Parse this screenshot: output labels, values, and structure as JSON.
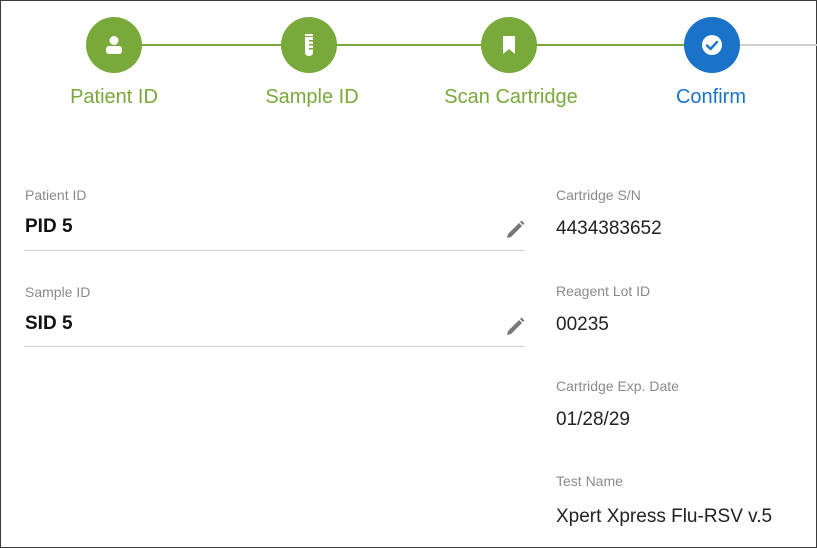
{
  "stepper": {
    "steps": [
      {
        "label": "Patient ID",
        "icon": "person-icon",
        "state": "complete"
      },
      {
        "label": "Sample ID",
        "icon": "sample-tube-icon",
        "state": "complete"
      },
      {
        "label": "Scan Cartridge",
        "icon": "cartridge-icon",
        "state": "complete"
      },
      {
        "label": "Confirm",
        "icon": "check-icon",
        "state": "active"
      }
    ],
    "colors": {
      "complete": "#78a93a",
      "active": "#1a73c8",
      "pending_line": "#cfcfcf"
    }
  },
  "form": {
    "patient_id": {
      "label": "Patient ID",
      "value": "PID 5"
    },
    "sample_id": {
      "label": "Sample ID",
      "value": "SID 5"
    }
  },
  "details": {
    "cartridge_sn": {
      "label": "Cartridge S/N",
      "value": "4434383652"
    },
    "reagent_lot": {
      "label": "Reagent Lot ID",
      "value": "00235"
    },
    "exp_date": {
      "label": "Cartridge Exp. Date",
      "value": "01/28/29"
    },
    "test_name": {
      "label": "Test Name",
      "value": "Xpert Xpress Flu-RSV v.5"
    }
  }
}
